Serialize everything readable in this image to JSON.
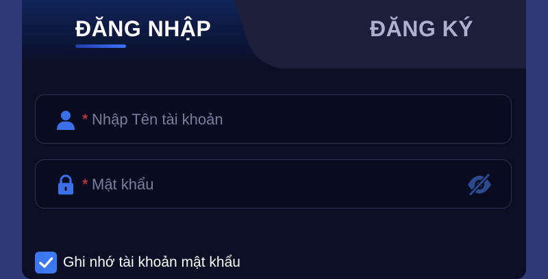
{
  "tabs": {
    "login_label": "ĐĂNG NHẬP",
    "register_label": "ĐĂNG KÝ"
  },
  "username": {
    "required_mark": "*",
    "placeholder": "Nhập Tên tài khoản",
    "icon": "user-icon"
  },
  "password": {
    "required_mark": "*",
    "placeholder": "Mật khẩu",
    "icon": "lock-icon",
    "toggle_icon": "eye-off-icon"
  },
  "remember": {
    "label": "Ghi nhớ tài khoản mật khẩu",
    "checked": true
  },
  "colors": {
    "accent": "#3a78f0",
    "required": "#e0433d",
    "panel_bg": "#0b0e24",
    "page_bg": "#2f3b78"
  }
}
